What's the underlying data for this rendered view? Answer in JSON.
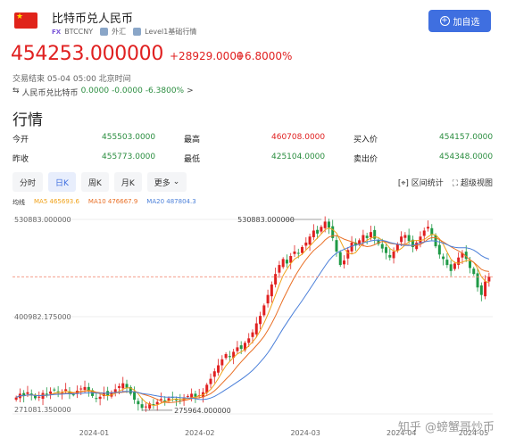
{
  "header": {
    "flag_glyph": "★",
    "title": "比特币兑人民币",
    "market_badge": "FX",
    "symbol": "BTCCNY",
    "tag1": "外汇",
    "tag2": "Level1基础行情",
    "add_button": "加自选"
  },
  "quote": {
    "price": "454253.000000",
    "change": "+28929.0000",
    "change_pct": "+6.8000%",
    "status": "交易结束 05-04 05:00 北京时间",
    "reverse_label": "人民币兑比特币",
    "reverse_price": "0.0000",
    "reverse_change": "-0.0000",
    "reverse_pct": "-6.3800%",
    "reverse_arrow": ">"
  },
  "section_title": "行情",
  "stats": [
    [
      {
        "label": "今开",
        "value": "455503.0000",
        "color": "#2a8d3f"
      },
      {
        "label": "最高",
        "value": "460708.0000",
        "color": "#e02020"
      },
      {
        "label": "买入价",
        "value": "454157.0000",
        "color": "#2a8d3f"
      }
    ],
    [
      {
        "label": "昨收",
        "value": "455773.0000",
        "color": "#2a8d3f"
      },
      {
        "label": "最低",
        "value": "425104.0000",
        "color": "#2a8d3f"
      },
      {
        "label": "卖出价",
        "value": "454348.0000",
        "color": "#2a8d3f"
      }
    ]
  ],
  "period_buttons": [
    "分时",
    "日K",
    "周K",
    "月K",
    "更多"
  ],
  "active_period": 1,
  "tools": {
    "range_stats": "区间统计",
    "super_view": "超级视图"
  },
  "ma_legend": {
    "title": "均线",
    "ma5": "MA5 465693.6",
    "ma10": "MA10 476667.9",
    "ma20": "MA20 487804.3"
  },
  "chart_labels": {
    "y_top": "530883.000000",
    "y_mid": "400982.175000",
    "y_bottom": "271081.350000",
    "high_marker": "530883.000000",
    "low_marker": "275964.000000"
  },
  "chart_data": {
    "type": "candlestick",
    "x_ticks": [
      "2024-01",
      "2024-02",
      "2024-03",
      "2024-04",
      "2024-05"
    ],
    "y_ticks": [
      530883.0,
      400982.175,
      271081.35
    ],
    "ylim": [
      271081.35,
      530883.0
    ],
    "highest": 530883.0,
    "lowest": 275964.0,
    "last_price": 454253.0,
    "colors": {
      "up": "#e02020",
      "down": "#1f9a46",
      "ma5": "#f0a21a",
      "ma10": "#e96f25",
      "ma20": "#4a7fd9"
    },
    "candles_close": [
      293000,
      298000,
      295000,
      300000,
      296000,
      292000,
      294000,
      299000,
      297000,
      301000,
      303000,
      299000,
      300000,
      304000,
      298000,
      297000,
      302000,
      305000,
      307000,
      301000,
      295000,
      292000,
      294000,
      299000,
      296000,
      300000,
      304000,
      308000,
      312000,
      306000,
      298000,
      290000,
      284000,
      279000,
      281000,
      285000,
      283000,
      287000,
      291000,
      289000,
      292000,
      293000,
      290000,
      288000,
      292000,
      295000,
      298000,
      294000,
      296000,
      300000,
      310000,
      318000,
      328000,
      336000,
      344000,
      351000,
      347000,
      354000,
      360000,
      358000,
      366000,
      372000,
      380000,
      392000,
      402000,
      416000,
      430000,
      444000,
      458000,
      470000,
      478000,
      472000,
      482000,
      488000,
      486000,
      494000,
      500000,
      508000,
      516000,
      512000,
      521000,
      528000,
      520000,
      506000,
      488000,
      470000,
      476000,
      490000,
      500000,
      496000,
      503000,
      510000,
      506000,
      514000,
      505000,
      498000,
      492000,
      486000,
      480000,
      488000,
      498000,
      508000,
      510000,
      502000,
      494000,
      500000,
      508000,
      516000,
      521000,
      510000,
      495000,
      484000,
      478000,
      470000,
      462000,
      472000,
      480000,
      486000,
      478000,
      466000,
      458000,
      440000,
      430000,
      448000,
      454253
    ]
  },
  "watermark": "知乎 @螃蟹哥炒币"
}
